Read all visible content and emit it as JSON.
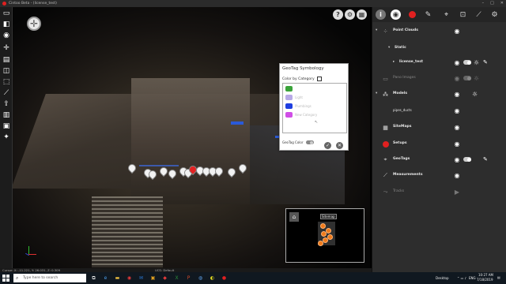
{
  "window": {
    "title": "Cintoo Beta - (license_test)"
  },
  "left_toolbar": {
    "icons": [
      "folder-icon",
      "split-view-icon",
      "eye-icon",
      "measure-icon",
      "layers-icon",
      "cube-icon",
      "box-select-icon",
      "ruler-icon",
      "upload-icon",
      "section-icon",
      "camera-icon",
      "puzzle-icon"
    ]
  },
  "viewport": {
    "top_icons": [
      "?",
      "⚙",
      "▦"
    ]
  },
  "dialog": {
    "title": "GeoTag Symbology",
    "color_by_category_label": "Color by Category",
    "categories": [
      {
        "label": "",
        "color": "#3aa33a"
      },
      {
        "label": "Light",
        "color": "#b7a9e6"
      },
      {
        "label": "Plumbings",
        "color": "#1f3fe0"
      },
      {
        "label": "New Category",
        "color": "#d04ee6"
      }
    ],
    "geotag_color_label": "GeoTag Color"
  },
  "minimap": {
    "label": "Sitemap"
  },
  "statusbar": {
    "cursor": "Cursor: X: -11.221, Y: 26.031, Z: 0.309",
    "ucs": "UCS: Default"
  },
  "panel": {
    "tabs": [
      "info",
      "view",
      "record",
      "markup",
      "pin",
      "snapshot",
      "measure",
      "settings"
    ],
    "rows": [
      {
        "label": "Point Clouds",
        "bold": true
      },
      {
        "label": "Static",
        "bold": true
      },
      {
        "label": "license_test",
        "bold": true
      },
      {
        "label": "Pano Images",
        "dim": true
      },
      {
        "label": "Models",
        "bold": true
      },
      {
        "label": "pipes_ducts",
        "bold": false
      },
      {
        "label": "SiteMaps",
        "bold": true
      },
      {
        "label": "Setups",
        "bold": true
      },
      {
        "label": "GeoTags",
        "bold": true
      },
      {
        "label": "Measurements",
        "bold": true
      },
      {
        "label": "Tracks",
        "dim": true
      }
    ]
  },
  "taskbar": {
    "search_placeholder": "Type here to search",
    "desktop_label": "Desktop",
    "lang": "ENG",
    "time": "10:27 AM",
    "date": "7/18/2019"
  },
  "colors": {
    "accent": "#e02020",
    "panel_bg": "#2d2d2d",
    "orange": "#f07a1a"
  }
}
